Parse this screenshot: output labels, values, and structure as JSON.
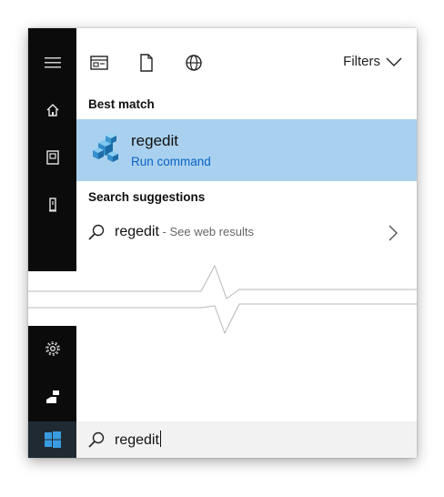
{
  "toolbar": {
    "filters_label": "Filters"
  },
  "sections": {
    "best_match_heading": "Best match",
    "suggestions_heading": "Search suggestions"
  },
  "best_match": {
    "title": "regedit",
    "subtitle": "Run command"
  },
  "suggestion": {
    "query": "regedit",
    "hint": " - See web results"
  },
  "search": {
    "value": "regedit"
  },
  "colors": {
    "rail": "#0b0b0b",
    "highlight": "#a9d1ef",
    "link": "#0b63c4",
    "search_bg": "#f2f2f2"
  },
  "icons": {
    "rail": [
      "hamburger-icon",
      "home-icon",
      "photo-icon",
      "tower-icon",
      "settings-gear-icon",
      "user-icon",
      "windows-logo-icon"
    ],
    "toolbar": [
      "apps-filter-icon",
      "documents-filter-icon",
      "web-filter-icon",
      "chevron-down-icon"
    ],
    "results": [
      "regedit-app-icon",
      "search-icon",
      "chevron-right-icon"
    ]
  }
}
